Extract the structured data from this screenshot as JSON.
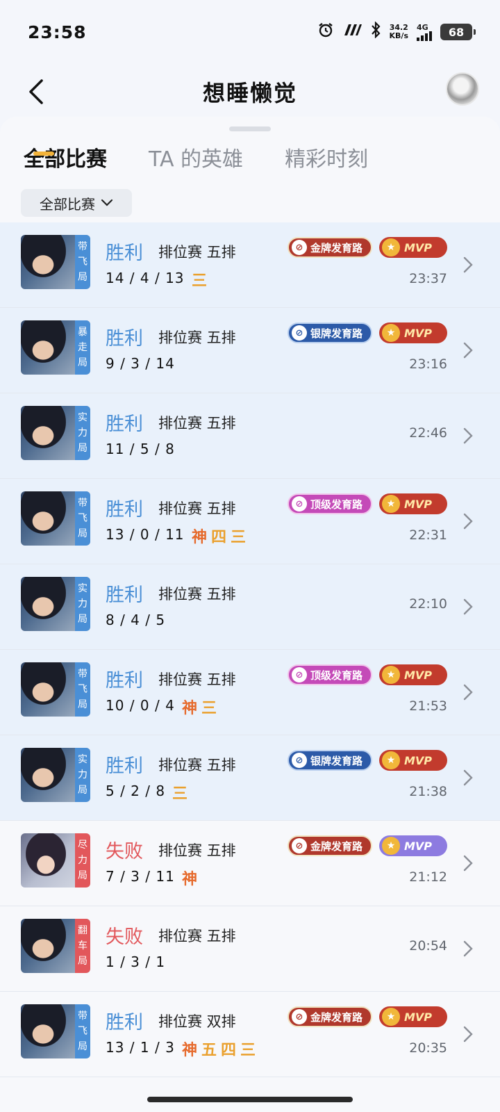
{
  "status_bar": {
    "time": "23:58",
    "net_speed_value": "34.2",
    "net_speed_unit": "KB/s",
    "network": "4G",
    "battery": "68",
    "icons": [
      "alarm-icon",
      "nfc-icon",
      "bluetooth-icon",
      "signal-icon",
      "battery-icon"
    ]
  },
  "header": {
    "title": "想睡懒觉"
  },
  "tabs": [
    {
      "label": "全部比赛",
      "active": true
    },
    {
      "label": "TA 的英雄",
      "active": false
    },
    {
      "label": "精彩时刻",
      "active": false
    }
  ],
  "filter": {
    "label": "全部比赛"
  },
  "colors": {
    "win": "#4a8fd6",
    "lose": "#e2575b",
    "accent": "#f3b33a"
  },
  "matches": [
    {
      "hero": "male",
      "tier": [
        "带",
        "飞",
        "局"
      ],
      "result": "胜利",
      "outcome": "win",
      "mode": "排位赛 五排",
      "kda": "14 / 4 / 13",
      "honors": [
        "三"
      ],
      "lane": "金牌发育路",
      "lane_tier": "gold",
      "mvp": "MVP",
      "mvp_style": "red",
      "time": "23:37",
      "tint": true
    },
    {
      "hero": "male",
      "tier": [
        "暴",
        "走",
        "局"
      ],
      "result": "胜利",
      "outcome": "win",
      "mode": "排位赛 五排",
      "kda": "9 / 3 / 14",
      "honors": [],
      "lane": "银牌发育路",
      "lane_tier": "silver",
      "mvp": "MVP",
      "mvp_style": "red",
      "time": "23:16",
      "tint": true
    },
    {
      "hero": "male",
      "tier": [
        "实",
        "力",
        "局"
      ],
      "result": "胜利",
      "outcome": "win",
      "mode": "排位赛 五排",
      "kda": "11 / 5 / 8",
      "honors": [],
      "lane": "",
      "lane_tier": "",
      "mvp": "",
      "mvp_style": "",
      "time": "22:46",
      "tint": true
    },
    {
      "hero": "male",
      "tier": [
        "带",
        "飞",
        "局"
      ],
      "result": "胜利",
      "outcome": "win",
      "mode": "排位赛 五排",
      "kda": "13 / 0 / 11",
      "honors": [
        "神",
        "四",
        "三"
      ],
      "lane": "顶级发育路",
      "lane_tier": "top",
      "mvp": "MVP",
      "mvp_style": "red",
      "time": "22:31",
      "tint": true
    },
    {
      "hero": "male",
      "tier": [
        "实",
        "力",
        "局"
      ],
      "result": "胜利",
      "outcome": "win",
      "mode": "排位赛 五排",
      "kda": "8 / 4 / 5",
      "honors": [],
      "lane": "",
      "lane_tier": "",
      "mvp": "",
      "mvp_style": "",
      "time": "22:10",
      "tint": true
    },
    {
      "hero": "male",
      "tier": [
        "带",
        "飞",
        "局"
      ],
      "result": "胜利",
      "outcome": "win",
      "mode": "排位赛 五排",
      "kda": "10 / 0 / 4",
      "honors": [
        "神",
        "三"
      ],
      "lane": "顶级发育路",
      "lane_tier": "top",
      "mvp": "MVP",
      "mvp_style": "red",
      "time": "21:53",
      "tint": true
    },
    {
      "hero": "male",
      "tier": [
        "实",
        "力",
        "局"
      ],
      "result": "胜利",
      "outcome": "win",
      "mode": "排位赛 五排",
      "kda": "5 / 2 / 8",
      "honors": [
        "三"
      ],
      "lane": "银牌发育路",
      "lane_tier": "silver",
      "mvp": "MVP",
      "mvp_style": "red",
      "time": "21:38",
      "tint": true
    },
    {
      "hero": "female",
      "tier": [
        "尽",
        "力",
        "局"
      ],
      "result": "失败",
      "outcome": "lose",
      "mode": "排位赛 五排",
      "kda": "7 / 3 / 11",
      "honors": [
        "神"
      ],
      "lane": "金牌发育路",
      "lane_tier": "gold",
      "mvp": "MVP",
      "mvp_style": "purple",
      "time": "21:12",
      "tint": false
    },
    {
      "hero": "male",
      "tier": [
        "翻",
        "车",
        "局"
      ],
      "result": "失败",
      "outcome": "lose",
      "mode": "排位赛 五排",
      "kda": "1 / 3 / 1",
      "honors": [],
      "lane": "",
      "lane_tier": "",
      "mvp": "",
      "mvp_style": "",
      "time": "20:54",
      "tint": false
    },
    {
      "hero": "male",
      "tier": [
        "带",
        "飞",
        "局"
      ],
      "result": "胜利",
      "outcome": "win",
      "mode": "排位赛 双排",
      "kda": "13 / 1 / 3",
      "honors": [
        "神",
        "五",
        "四",
        "三"
      ],
      "lane": "金牌发育路",
      "lane_tier": "gold",
      "mvp": "MVP",
      "mvp_style": "red",
      "time": "20:35",
      "tint": false
    }
  ]
}
